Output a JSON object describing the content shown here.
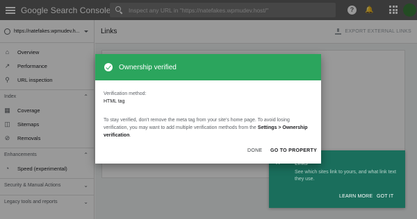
{
  "topbar": {
    "brand": "Google Search Console",
    "search_placeholder": "Inspect any URL in \"https://natefakes.wpmudev.host/\"",
    "help_icon": "help-icon",
    "notifications_icon": "bell-icon",
    "apps_icon": "apps-grid-icon"
  },
  "sidebar": {
    "property": "https://natefakes.wpmudev.h...",
    "items": [
      {
        "label": "Overview",
        "icon": "home-icon"
      },
      {
        "label": "Performance",
        "icon": "trending-icon"
      },
      {
        "label": "URL inspection",
        "icon": "search-icon"
      }
    ],
    "index_section": "Index",
    "index_items": [
      {
        "label": "Coverage",
        "icon": "coverage-icon"
      },
      {
        "label": "Sitemaps",
        "icon": "sitemap-icon"
      },
      {
        "label": "Removals",
        "icon": "removals-icon"
      }
    ],
    "enhancements_section": "Enhancements",
    "enhancement_items": [
      {
        "label": "Speed (experimental)",
        "icon": "speed-icon"
      }
    ],
    "security_section": "Security & Manual Actions",
    "legacy_section": "Legacy tools and reports"
  },
  "main": {
    "title": "Links",
    "export_label": "EXPORT EXTERNAL LINKS"
  },
  "dialog": {
    "title": "Ownership verified",
    "method_label": "Verification method:",
    "method_value": "HTML tag",
    "body_text": "To stay verified, don't remove the meta tag from your site's home page. To avoid losing verification, you may want to add multiple verification methods from the",
    "body_link": "Settings > Ownership verification",
    "body_end": ".",
    "done_label": "DONE",
    "goto_label": "GO TO PROPERTY"
  },
  "promo": {
    "title": "Links",
    "text": "See which sites link to yours, and what link text they use.",
    "learn_more": "LEARN MORE",
    "got_it": "GOT IT"
  },
  "colors": {
    "topbar": "#616161",
    "dialog_header": "#2ba55d",
    "promo_bg": "#1a6e5c"
  }
}
